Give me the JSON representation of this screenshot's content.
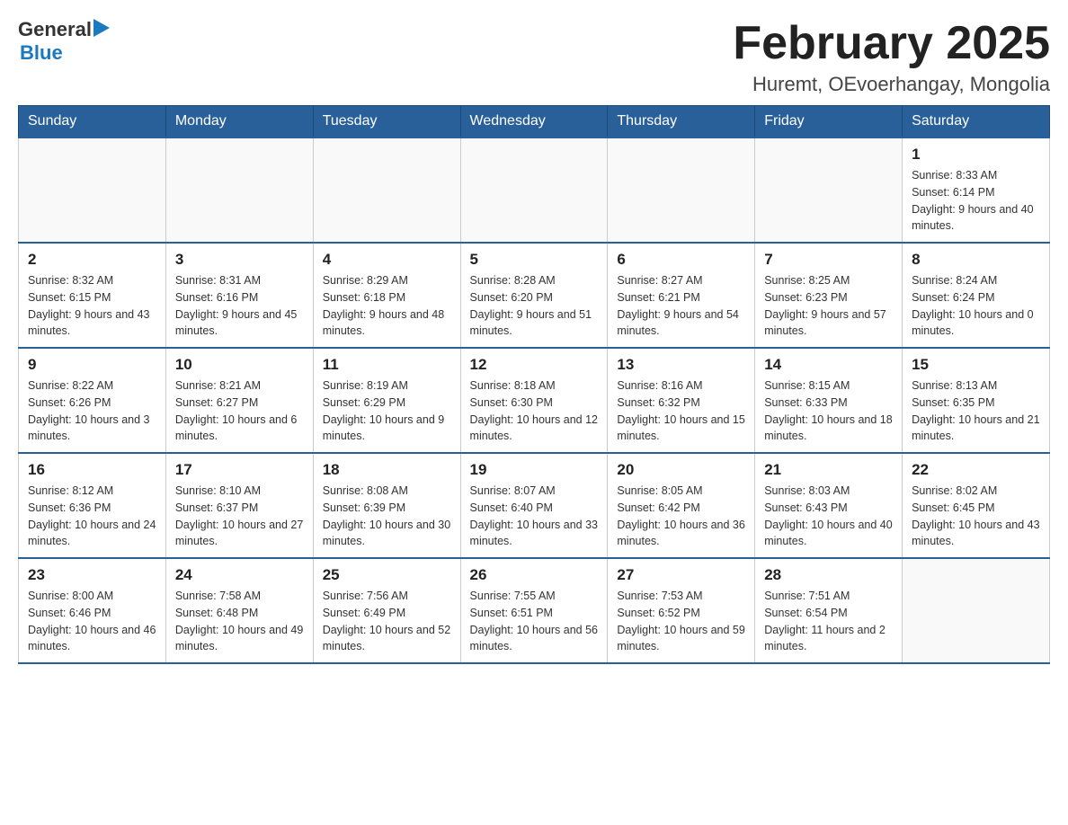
{
  "header": {
    "logo_general": "General",
    "logo_blue": "Blue",
    "month_title": "February 2025",
    "location": "Huremt, OEvoerhangay, Mongolia"
  },
  "days_of_week": [
    "Sunday",
    "Monday",
    "Tuesday",
    "Wednesday",
    "Thursday",
    "Friday",
    "Saturday"
  ],
  "weeks": [
    [
      {
        "day": "",
        "info": ""
      },
      {
        "day": "",
        "info": ""
      },
      {
        "day": "",
        "info": ""
      },
      {
        "day": "",
        "info": ""
      },
      {
        "day": "",
        "info": ""
      },
      {
        "day": "",
        "info": ""
      },
      {
        "day": "1",
        "info": "Sunrise: 8:33 AM\nSunset: 6:14 PM\nDaylight: 9 hours and 40 minutes."
      }
    ],
    [
      {
        "day": "2",
        "info": "Sunrise: 8:32 AM\nSunset: 6:15 PM\nDaylight: 9 hours and 43 minutes."
      },
      {
        "day": "3",
        "info": "Sunrise: 8:31 AM\nSunset: 6:16 PM\nDaylight: 9 hours and 45 minutes."
      },
      {
        "day": "4",
        "info": "Sunrise: 8:29 AM\nSunset: 6:18 PM\nDaylight: 9 hours and 48 minutes."
      },
      {
        "day": "5",
        "info": "Sunrise: 8:28 AM\nSunset: 6:20 PM\nDaylight: 9 hours and 51 minutes."
      },
      {
        "day": "6",
        "info": "Sunrise: 8:27 AM\nSunset: 6:21 PM\nDaylight: 9 hours and 54 minutes."
      },
      {
        "day": "7",
        "info": "Sunrise: 8:25 AM\nSunset: 6:23 PM\nDaylight: 9 hours and 57 minutes."
      },
      {
        "day": "8",
        "info": "Sunrise: 8:24 AM\nSunset: 6:24 PM\nDaylight: 10 hours and 0 minutes."
      }
    ],
    [
      {
        "day": "9",
        "info": "Sunrise: 8:22 AM\nSunset: 6:26 PM\nDaylight: 10 hours and 3 minutes."
      },
      {
        "day": "10",
        "info": "Sunrise: 8:21 AM\nSunset: 6:27 PM\nDaylight: 10 hours and 6 minutes."
      },
      {
        "day": "11",
        "info": "Sunrise: 8:19 AM\nSunset: 6:29 PM\nDaylight: 10 hours and 9 minutes."
      },
      {
        "day": "12",
        "info": "Sunrise: 8:18 AM\nSunset: 6:30 PM\nDaylight: 10 hours and 12 minutes."
      },
      {
        "day": "13",
        "info": "Sunrise: 8:16 AM\nSunset: 6:32 PM\nDaylight: 10 hours and 15 minutes."
      },
      {
        "day": "14",
        "info": "Sunrise: 8:15 AM\nSunset: 6:33 PM\nDaylight: 10 hours and 18 minutes."
      },
      {
        "day": "15",
        "info": "Sunrise: 8:13 AM\nSunset: 6:35 PM\nDaylight: 10 hours and 21 minutes."
      }
    ],
    [
      {
        "day": "16",
        "info": "Sunrise: 8:12 AM\nSunset: 6:36 PM\nDaylight: 10 hours and 24 minutes."
      },
      {
        "day": "17",
        "info": "Sunrise: 8:10 AM\nSunset: 6:37 PM\nDaylight: 10 hours and 27 minutes."
      },
      {
        "day": "18",
        "info": "Sunrise: 8:08 AM\nSunset: 6:39 PM\nDaylight: 10 hours and 30 minutes."
      },
      {
        "day": "19",
        "info": "Sunrise: 8:07 AM\nSunset: 6:40 PM\nDaylight: 10 hours and 33 minutes."
      },
      {
        "day": "20",
        "info": "Sunrise: 8:05 AM\nSunset: 6:42 PM\nDaylight: 10 hours and 36 minutes."
      },
      {
        "day": "21",
        "info": "Sunrise: 8:03 AM\nSunset: 6:43 PM\nDaylight: 10 hours and 40 minutes."
      },
      {
        "day": "22",
        "info": "Sunrise: 8:02 AM\nSunset: 6:45 PM\nDaylight: 10 hours and 43 minutes."
      }
    ],
    [
      {
        "day": "23",
        "info": "Sunrise: 8:00 AM\nSunset: 6:46 PM\nDaylight: 10 hours and 46 minutes."
      },
      {
        "day": "24",
        "info": "Sunrise: 7:58 AM\nSunset: 6:48 PM\nDaylight: 10 hours and 49 minutes."
      },
      {
        "day": "25",
        "info": "Sunrise: 7:56 AM\nSunset: 6:49 PM\nDaylight: 10 hours and 52 minutes."
      },
      {
        "day": "26",
        "info": "Sunrise: 7:55 AM\nSunset: 6:51 PM\nDaylight: 10 hours and 56 minutes."
      },
      {
        "day": "27",
        "info": "Sunrise: 7:53 AM\nSunset: 6:52 PM\nDaylight: 10 hours and 59 minutes."
      },
      {
        "day": "28",
        "info": "Sunrise: 7:51 AM\nSunset: 6:54 PM\nDaylight: 11 hours and 2 minutes."
      },
      {
        "day": "",
        "info": ""
      }
    ]
  ]
}
